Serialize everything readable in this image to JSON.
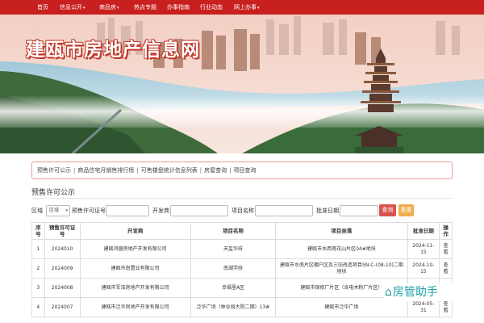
{
  "nav": {
    "items": [
      {
        "label": "首页",
        "caret": false
      },
      {
        "label": "信息公开",
        "caret": true
      },
      {
        "label": "商品房",
        "caret": true
      },
      {
        "label": "热点专题",
        "caret": false
      },
      {
        "label": "办事指南",
        "caret": false
      },
      {
        "label": "行业动态",
        "caret": false
      },
      {
        "label": "网上办事",
        "caret": true
      }
    ],
    "caret_glyph": "▾"
  },
  "banner": {
    "title": "建瓯市房地产信息网"
  },
  "tabs": {
    "separator": "|",
    "items": [
      "预售许可公示",
      "商品住宅月销售排行榜",
      "可售楼盘统计信息列表",
      "房屋查询",
      "项目查询"
    ]
  },
  "section": {
    "title": "预售许可公示"
  },
  "filter": {
    "region_label": "区域",
    "region_value": "区域",
    "permit_label": "预售许可证号",
    "developer_label": "开发商",
    "project_label": "项目名称",
    "date_label": "批准日期",
    "query_label": "查询",
    "reset_label": "重置"
  },
  "table": {
    "headers": [
      "序号",
      "预售许可证号",
      "开发商",
      "项目名称",
      "项目坐落",
      "批准日期",
      "操作"
    ],
    "rows": [
      {
        "no": "1",
        "permit": "2024010",
        "developer": "建瓯鸿盛房地产开发有限公司",
        "project": "天玺华府",
        "location": "建瓯市水西莲花山片区04#地块",
        "date": "2024-11-15",
        "action": "查看"
      },
      {
        "no": "2",
        "permit": "2024009",
        "developer": "建瓯市南置业有限公司",
        "project": "南湖学府",
        "location": "建瓯市水南片区棚户区及三旧改造项目SN-C-(08-10)二期地块",
        "date": "2024-10-15",
        "action": "查看"
      },
      {
        "no": "3",
        "permit": "2024008",
        "developer": "建瓯市军浩房地产开发有限公司",
        "project": "幸福里A区",
        "location": "建瓯市保修厂片区（含电木粉厂片区）",
        "date": "",
        "action": ""
      },
      {
        "no": "4",
        "permit": "2024007",
        "developer": "建瓯市泛华房地产开发有限公司",
        "project": "泛华广场（林业局大院二期）13#",
        "location": "建瓯市泛华广场",
        "date": "2024-05-31",
        "action": "查看"
      }
    ]
  },
  "watermark": {
    "icon": "⌂",
    "text": "房管助手"
  },
  "colors": {
    "nav_bg": "#c81f1f",
    "tab_border": "#e59b9b",
    "query_btn": "#d9534f",
    "reset_btn": "#f0ad4e",
    "watermark": "#1ca0a5"
  }
}
